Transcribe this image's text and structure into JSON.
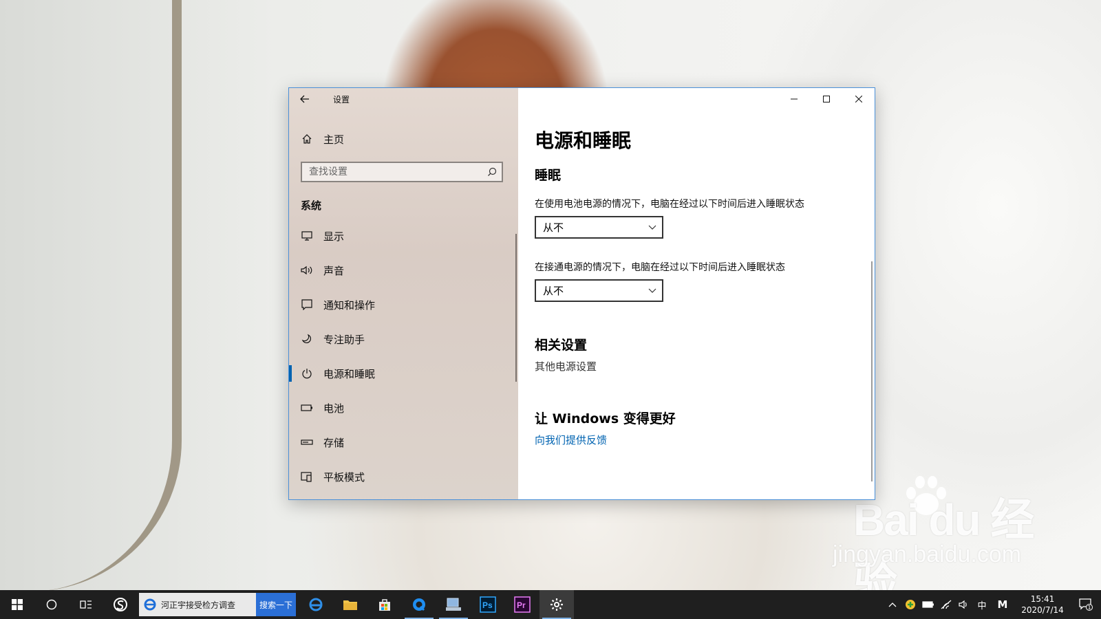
{
  "window": {
    "app_title": "设置",
    "home_label": "主页",
    "search_placeholder": "查找设置",
    "section_label": "系统"
  },
  "sidebar": {
    "items": [
      {
        "label": "显示",
        "icon": "monitor-icon"
      },
      {
        "label": "声音",
        "icon": "speaker-icon"
      },
      {
        "label": "通知和操作",
        "icon": "notification-icon"
      },
      {
        "label": "专注助手",
        "icon": "moon-icon"
      },
      {
        "label": "电源和睡眠",
        "icon": "power-icon",
        "active": true
      },
      {
        "label": "电池",
        "icon": "battery-icon"
      },
      {
        "label": "存储",
        "icon": "storage-icon"
      },
      {
        "label": "平板模式",
        "icon": "tablet-mode-icon"
      }
    ]
  },
  "content": {
    "title": "电源和睡眠",
    "sleep_heading": "睡眠",
    "battery_desc": "在使用电池电源的情况下，电脑在经过以下时间后进入睡眠状态",
    "battery_value": "从不",
    "plugged_desc": "在接通电源的情况下，电脑在经过以下时间后进入睡眠状态",
    "plugged_value": "从不",
    "related_heading": "相关设置",
    "related_link": "其他电源设置",
    "feedback_heading": "让 Windows 变得更好",
    "feedback_link": "向我们提供反馈"
  },
  "taskbar": {
    "search_text": "河正宇接受检方调查",
    "search_button": "搜索一下",
    "ime": "中",
    "ime_mode": "M",
    "time": "15:41",
    "date": "2020/7/14",
    "notifications": "1"
  },
  "watermark": {
    "brand": "Bai du 经验",
    "url": "jingyan.baidu.com"
  },
  "colors": {
    "accent": "#0063b1",
    "window_border": "#4a90d9",
    "taskbar": "#1f1f1f"
  }
}
